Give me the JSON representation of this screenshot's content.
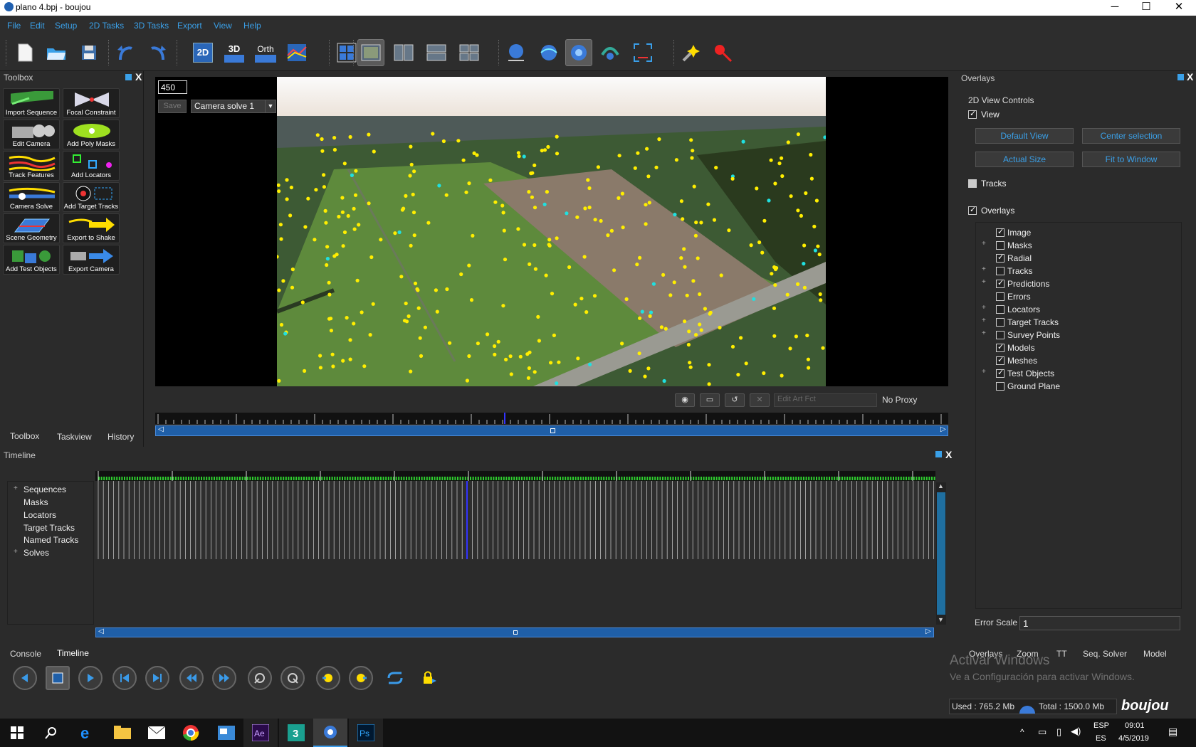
{
  "window": {
    "title": "plano 4.bpj - boujou",
    "minimize": "─",
    "maximize": "☐",
    "close": "✕"
  },
  "menu": [
    "File",
    "Edit",
    "Setup",
    "2D Tasks",
    "3D Tasks",
    "Export",
    "View",
    "Help"
  ],
  "toolbar": {
    "btn_2d": "2D",
    "btn_3d": "3D",
    "btn_orth": "Orth"
  },
  "toolbox": {
    "title": "Toolbox",
    "close": "X",
    "tools": [
      "Import Sequence",
      "Focal Constraint",
      "Edit Camera",
      "Add Poly Masks",
      "Track Features",
      "Add Locators",
      "Camera Solve",
      "Add Target Tracks",
      "Scene Geometry",
      "Export to Shake",
      "Add Test Objects",
      "Export Camera"
    ],
    "tabs": [
      "Toolbox",
      "Taskview",
      "History"
    ]
  },
  "viewer": {
    "frame": "450",
    "save_label": "Save",
    "camera_solve": "Camera solve 1",
    "art_fx_placeholder": "Edit Art Fct",
    "proxy": "No Proxy"
  },
  "timeline": {
    "title": "Timeline",
    "close": "X",
    "nodes": [
      "Sequences",
      "Masks",
      "Locators",
      "Target Tracks",
      "Named Tracks",
      "Solves"
    ],
    "bottom_tabs": [
      "Console",
      "Timeline"
    ]
  },
  "overlays": {
    "title": "Overlays",
    "close": "X",
    "section": "2D View Controls",
    "view_label": "View",
    "buttons": [
      "Default View",
      "Center selection",
      "Actual Size",
      "Fit to Window"
    ],
    "tracks_label": "Tracks",
    "overlays_label": "Overlays",
    "items": [
      {
        "label": "Image",
        "checked": true,
        "expand": false
      },
      {
        "label": "Masks",
        "checked": false,
        "expand": true
      },
      {
        "label": "Radial",
        "checked": true,
        "expand": false
      },
      {
        "label": "Tracks",
        "checked": false,
        "expand": true
      },
      {
        "label": "Predictions",
        "checked": true,
        "expand": true
      },
      {
        "label": "Errors",
        "checked": false,
        "expand": false
      },
      {
        "label": "Locators",
        "checked": false,
        "expand": true
      },
      {
        "label": "Target Tracks",
        "checked": false,
        "expand": true
      },
      {
        "label": "Survey Points",
        "checked": false,
        "expand": true
      },
      {
        "label": "Models",
        "checked": true,
        "expand": false
      },
      {
        "label": "Meshes",
        "checked": true,
        "expand": false
      },
      {
        "label": "Test Objects",
        "checked": true,
        "expand": true
      },
      {
        "label": "Ground Plane",
        "checked": false,
        "expand": false
      }
    ],
    "error_scale_label": "Error Scale",
    "error_scale_value": "1",
    "tabs": [
      "Overlays",
      "Zoom",
      "TT",
      "Seq. Solver",
      "Model"
    ]
  },
  "activation": {
    "line1": "Activar Windows",
    "line2": "Ve a Configuración para activar Windows."
  },
  "status": {
    "used": "Used : 765.2 Mb",
    "total": "Total : 1500.0 Mb",
    "brand": "boujou"
  },
  "taskbar": {
    "lang1": "ESP",
    "lang2": "ES",
    "time": "09:01",
    "date": "4/5/2019"
  },
  "colors": {
    "accent": "#3aa0e8",
    "track_yellow": "#ffee00",
    "track_cyan": "#20e0e0",
    "timeline_blue": "#1f5fa8"
  }
}
